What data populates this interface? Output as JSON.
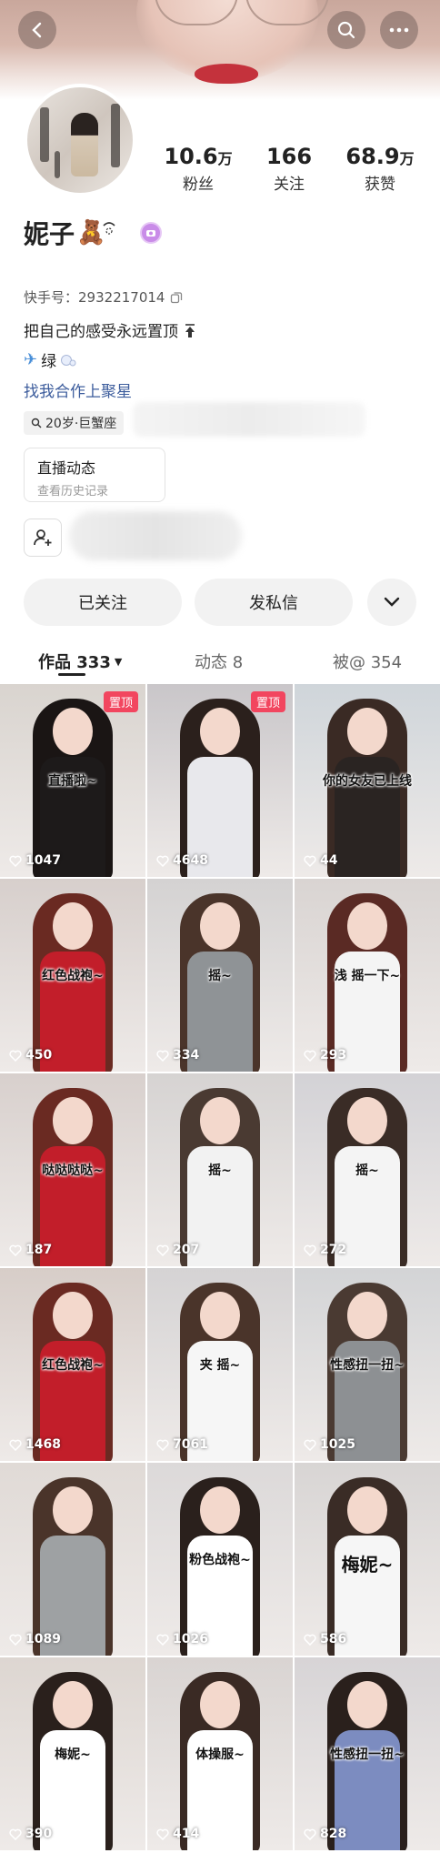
{
  "profile": {
    "name": "妮子",
    "kuaishou_label": "快手号：",
    "kuaishou_id": "2932217014",
    "bio_line1": "把自己的感受永远置顶",
    "bio_line2": "绿",
    "bio_line3": "找我合作上聚星",
    "age_tag": "20岁·巨蟹座",
    "stats": [
      {
        "num": "10.6",
        "unit": "万",
        "label": "粉丝"
      },
      {
        "num": "166",
        "unit": "",
        "label": "关注"
      },
      {
        "num": "68.9",
        "unit": "万",
        "label": "获赞"
      }
    ]
  },
  "live_card": {
    "title": "直播动态",
    "subtitle": "查看历史记录"
  },
  "buttons": {
    "followed": "已关注",
    "message": "发私信"
  },
  "tabs": [
    {
      "label": "作品 333"
    },
    {
      "label": "动态 8"
    },
    {
      "label": "被@ 354"
    }
  ],
  "pin_label": "置顶",
  "videos": [
    {
      "caption": "直播啦~",
      "likes": "1047",
      "pinned": true
    },
    {
      "caption": "",
      "likes": "4648",
      "pinned": true
    },
    {
      "caption": "你的女友已上线",
      "likes": "44",
      "pinned": false
    },
    {
      "caption": "红色战袍~",
      "likes": "450",
      "pinned": false
    },
    {
      "caption": "摇~",
      "likes": "334",
      "pinned": false
    },
    {
      "caption": "浅 摇一下~",
      "likes": "293",
      "pinned": false
    },
    {
      "caption": "哒哒哒哒~",
      "likes": "187",
      "pinned": false
    },
    {
      "caption": "摇~",
      "likes": "207",
      "pinned": false
    },
    {
      "caption": "摇~",
      "likes": "272",
      "pinned": false
    },
    {
      "caption": "红色战袍~",
      "likes": "1468",
      "pinned": false
    },
    {
      "caption": "夹 摇~",
      "likes": "7061",
      "pinned": false
    },
    {
      "caption": "性感扭一扭~",
      "likes": "1025",
      "pinned": false
    },
    {
      "caption": "",
      "likes": "1089",
      "pinned": false
    },
    {
      "caption": "粉色战袍~",
      "likes": "1026",
      "pinned": false
    },
    {
      "caption": "梅妮~",
      "likes": "586",
      "pinned": false
    },
    {
      "caption": "梅妮~",
      "likes": "390",
      "pinned": false
    },
    {
      "caption": "体操服~",
      "likes": "414",
      "pinned": false
    },
    {
      "caption": "性感扭一扭~",
      "likes": "828",
      "pinned": false
    }
  ],
  "colors": {
    "pin": "#f2465f",
    "link": "#3c5c9c"
  }
}
